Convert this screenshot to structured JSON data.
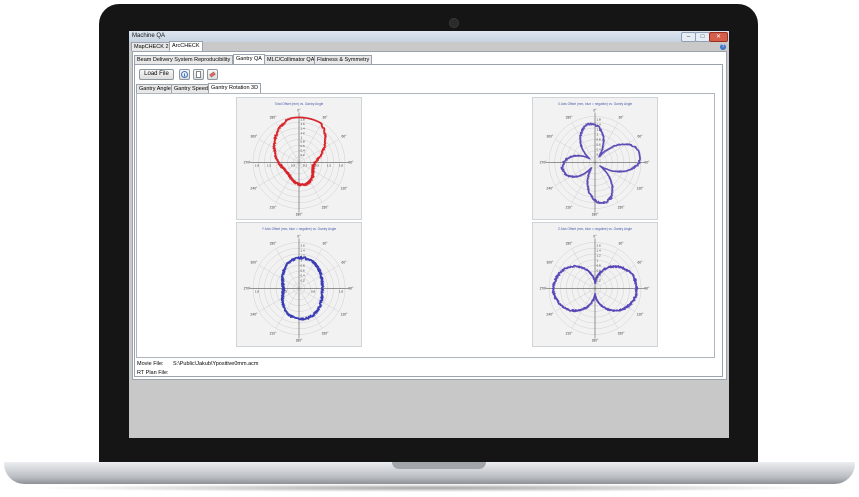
{
  "window": {
    "title": "Machine QA",
    "controls": {
      "minimize": "–",
      "maximize": "□",
      "close": "✕"
    },
    "help_glyph": "?"
  },
  "top_tabs": [
    {
      "label": "MapCHECK 2"
    },
    {
      "label": "ArcCHECK"
    }
  ],
  "qa_tabs": [
    {
      "label": "Beam Delivery System Reproducibility"
    },
    {
      "label": "Gantry QA"
    },
    {
      "label": "MLC/Collimator QA"
    },
    {
      "label": "Flatness & Symmetry"
    }
  ],
  "toolbar": {
    "load_file_label": "Load File",
    "icons": [
      "info-icon",
      "document-icon",
      "eraser-icon"
    ]
  },
  "gantry_tabs": [
    {
      "label": "Gantry Angle"
    },
    {
      "label": "Gantry Speed"
    },
    {
      "label": "Gantry Rotation 3D"
    }
  ],
  "plots": [
    {
      "title": "Total Offset (mm) vs. Gantry Angle",
      "color": "#d8232a",
      "angle_labels": [
        "0°",
        "30°",
        "60°",
        "90°",
        "120°",
        "150°",
        "180°",
        "210°",
        "240°",
        "270°",
        "300°",
        "330°"
      ],
      "radial_labels": [
        "1.8",
        "1.6",
        "1.4",
        "1.2",
        "1",
        "0.8",
        "0.6",
        "0.4",
        "0.2"
      ],
      "axis_labels": [
        "1.8",
        "1.5",
        "0.9",
        "0.3",
        "0.3",
        "0.9",
        "1.5",
        "1.8"
      ]
    },
    {
      "title": "X Axis Offset (mm, blue = negative) vs. Gantry Angle",
      "color": "#5d4fb6",
      "angle_labels": [
        "0°",
        "30°",
        "60°",
        "90°",
        "120°",
        "150°",
        "180°",
        "210°",
        "240°",
        "270°",
        "300°",
        "330°"
      ],
      "radial_labels": [
        "1.8",
        "1.4",
        "1.2",
        "1",
        "0.8",
        "0.6",
        "0.4",
        "0.2"
      ],
      "axis_labels": []
    },
    {
      "title": "Y Axis Offset (mm, blue = negative) vs. Gantry Angle",
      "color": "#3a3db3",
      "angle_labels": [
        "0°",
        "30°",
        "60°",
        "90°",
        "120°",
        "150°",
        "180°",
        "210°",
        "240°",
        "270°",
        "300°",
        "330°"
      ],
      "radial_labels": [
        "1.6",
        "1.4",
        "1.2",
        "1",
        "0.8",
        "0.6",
        "0.4",
        "0.2"
      ],
      "axis_labels": [
        "1.8",
        "0.8",
        "0.8",
        "1.8"
      ]
    },
    {
      "title": "Z Axis Offset (mm, blue = negative) vs. Gantry Angle",
      "color": "#5a45b8",
      "angle_labels": [
        "0°",
        "30°",
        "60°",
        "90°",
        "120°",
        "150°",
        "180°",
        "210°",
        "240°",
        "270°",
        "300°",
        "330°"
      ],
      "radial_labels": [
        "1.6",
        "1.4",
        "1.2",
        "1",
        "0.8",
        "0.6",
        "0.4",
        "0.2"
      ],
      "axis_labels": []
    }
  ],
  "file_info": {
    "movie_label": "Movie File:",
    "movie_value": "S:\\Public\\Jakub\\Ypositive0mm.acm",
    "plan_label": "RT Plan File:",
    "plan_value": ""
  }
}
